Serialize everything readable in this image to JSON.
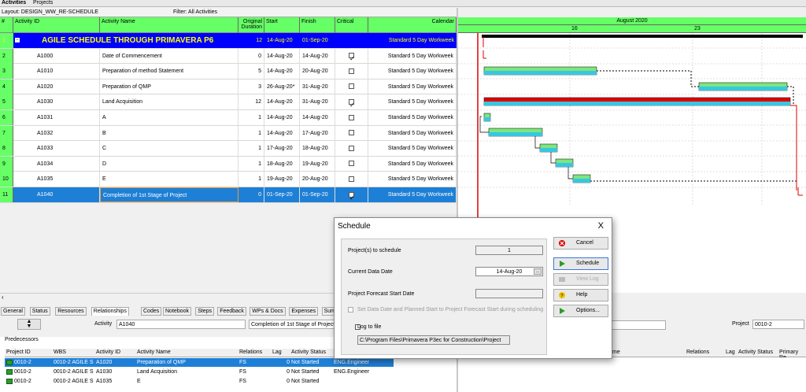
{
  "topbar": {
    "tab1": "Activities",
    "tab2": "Projects"
  },
  "layout_bar": {
    "layout": "Layout: DESIGN_WW_RE-SCHEDULE",
    "filter": "Filter: All Activities"
  },
  "columns": {
    "num": "#",
    "activity_id": "Activity ID",
    "activity_name": "Activity Name",
    "orig_dur": "Original Duration",
    "start": "Start",
    "finish": "Finish",
    "critical": "Critical",
    "calendar": "Calendar"
  },
  "rows": [
    {
      "num": "1",
      "id": "AGILE SCHEDULE THROUGH PRIMAVERA P6",
      "name": "",
      "dur": "12",
      "start": "14-Aug-20",
      "finish": "01-Sep-20",
      "critical": null,
      "calendar": "Standard 5 Day Workweek"
    },
    {
      "num": "2",
      "id": "A1000",
      "name": "Date of Commencement",
      "dur": "0",
      "start": "14-Aug-20",
      "finish": "14-Aug-20",
      "critical": true,
      "calendar": "Standard 5 Day Workweek"
    },
    {
      "num": "3",
      "id": "A1010",
      "name": "Preparation of method Statement",
      "dur": "5",
      "start": "14-Aug-20",
      "finish": "20-Aug-20",
      "critical": false,
      "calendar": "Standard 5 Day Workweek"
    },
    {
      "num": "4",
      "id": "A1020",
      "name": "Preparation of QMP",
      "dur": "3",
      "start": "26-Aug-20*",
      "finish": "31-Aug-20",
      "critical": false,
      "calendar": "Standard 5 Day Workweek"
    },
    {
      "num": "5",
      "id": "A1030",
      "name": "Land Acquisition",
      "dur": "12",
      "start": "14-Aug-20",
      "finish": "31-Aug-20",
      "critical": true,
      "calendar": "Standard 5 Day Workweek"
    },
    {
      "num": "6",
      "id": "A1031",
      "name": "A",
      "dur": "1",
      "start": "14-Aug-20",
      "finish": "14-Aug-20",
      "critical": false,
      "calendar": "Standard 5 Day Workweek"
    },
    {
      "num": "7",
      "id": "A1032",
      "name": "B",
      "dur": "1",
      "start": "14-Aug-20",
      "finish": "17-Aug-20",
      "critical": false,
      "calendar": "Standard 5 Day Workweek"
    },
    {
      "num": "8",
      "id": "A1033",
      "name": "C",
      "dur": "1",
      "start": "17-Aug-20",
      "finish": "18-Aug-20",
      "critical": false,
      "calendar": "Standard 5 Day Workweek"
    },
    {
      "num": "9",
      "id": "A1034",
      "name": "D",
      "dur": "1",
      "start": "18-Aug-20",
      "finish": "19-Aug-20",
      "critical": false,
      "calendar": "Standard 5 Day Workweek"
    },
    {
      "num": "10",
      "id": "A1035",
      "name": "E",
      "dur": "1",
      "start": "19-Aug-20",
      "finish": "20-Aug-20",
      "critical": false,
      "calendar": "Standard 5 Day Workweek"
    },
    {
      "num": "11",
      "id": "A1040",
      "name": "Completion of 1st Stage of Project",
      "dur": "0",
      "start": "01-Sep-20",
      "finish": "01-Sep-20",
      "critical": true,
      "calendar": "Standard 5 Day Workweek"
    }
  ],
  "gantt": {
    "month": "August 2020",
    "week1": "16",
    "week2": "23"
  },
  "bottom_tabs": [
    "General",
    "Status",
    "Resources",
    "Relationships",
    "Codes",
    "Notebook",
    "Steps",
    "Feedback",
    "WPs & Docs",
    "Expenses",
    "Summary"
  ],
  "activity_line": {
    "label": "Activity",
    "id": "A1040",
    "name": "Completion of 1st Stage of Project",
    "project_label": "Project",
    "project": "0010-2"
  },
  "predecessors": {
    "title": "Predecessors",
    "headers": [
      "Project ID",
      "WBS",
      "Activity ID",
      "Activity Name",
      "Relations",
      "Lag",
      "Activity Status"
    ],
    "rows": [
      [
        "0010-2",
        "0010-2 AGILE S",
        "A1020",
        "Preparation of QMP",
        "FS",
        "0",
        "Not Started",
        "ENG.Engineer"
      ],
      [
        "0010-2",
        "0010-2 AGILE S",
        "A1030",
        "Land Acquisition",
        "FS",
        "0",
        "Not Started",
        "ENG.Engineer"
      ],
      [
        "0010-2",
        "0010-2 AGILE S",
        "A1035",
        "E",
        "FS",
        "0",
        "Not Started",
        ""
      ]
    ]
  },
  "successors": {
    "headers": [
      "me",
      "Relations",
      "Lag",
      "Activity Status",
      "Primary Re"
    ]
  },
  "dialog": {
    "title": "Schedule",
    "close": "X",
    "projects_label": "Project(s) to schedule",
    "projects_value": "1",
    "data_date_label": "Current Data Date",
    "data_date_value": "14-Aug-20",
    "forecast_label": "Project Forecast Start Date",
    "set_data_date_label": "Set Data Date and Planned Start to Project Forecast Start during scheduling",
    "log_label": "Log to file",
    "log_path": "C:\\Program Files\\Primavera P3ec for Construction\\Project",
    "buttons": {
      "cancel": "Cancel",
      "schedule": "Schedule",
      "view_log": "View Log",
      "help": "Help",
      "options": "Options..."
    }
  }
}
